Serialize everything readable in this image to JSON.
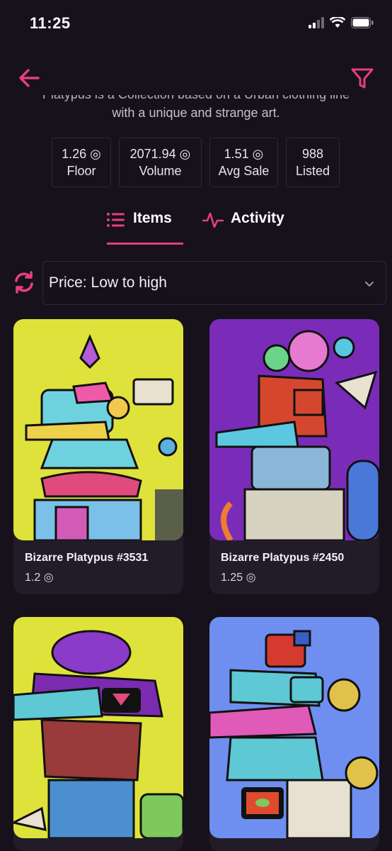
{
  "status": {
    "time": "11:25",
    "icons": [
      "signal-icon",
      "wifi-icon",
      "battery-icon"
    ]
  },
  "nav": {
    "back_icon": "arrow-left-icon",
    "filter_icon": "filter-icon"
  },
  "collection": {
    "description_line1": "Platypus is a Collection based on a Urban clothing line",
    "description_line2": "with a unique and strange art."
  },
  "stats": [
    {
      "value": "1.26 ◎",
      "label": "Floor"
    },
    {
      "value": "2071.94 ◎",
      "label": "Volume"
    },
    {
      "value": "1.51 ◎",
      "label": "Avg Sale"
    },
    {
      "value": "988",
      "label": "Listed"
    }
  ],
  "tabs": [
    {
      "label": "Items",
      "icon": "list-icon",
      "active": true
    },
    {
      "label": "Activity",
      "icon": "activity-icon",
      "active": false
    }
  ],
  "sort": {
    "refresh_icon": "refresh-icon",
    "selected": "Price: Low to high",
    "chevron_icon": "chevron-down-icon"
  },
  "items": [
    {
      "name": "Bizarre Platypus #3531",
      "price": "1.2 ◎"
    },
    {
      "name": "Bizarre Platypus #2450",
      "price": "1.25 ◎"
    },
    {
      "name": "",
      "price": ""
    },
    {
      "name": "",
      "price": ""
    }
  ],
  "colors": {
    "background": "#16111b",
    "accent": "#e5407a",
    "card": "#221c29",
    "border": "#2d2833"
  }
}
